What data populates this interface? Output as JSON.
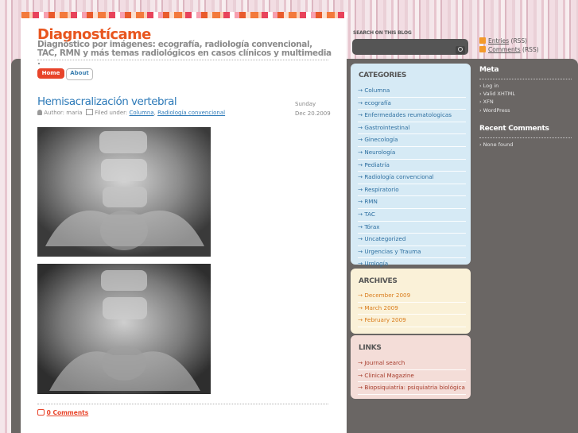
{
  "blog": {
    "title": "Diagnostícame",
    "tagline": "Diagnóstico por imágenes: ecografía, radiología convencional, TAC, RMN y más temas radiológicos en casos clínicos y multimedia ."
  },
  "nav": {
    "home": "Home",
    "about": "About"
  },
  "post": {
    "title": "Hemisacralización vertebral",
    "day": "Sunday",
    "date": "Dec 20.2009",
    "author_label": "Author: maria",
    "filed_label": "Filed under:",
    "categories": [
      "Columna",
      "Radiología convencional"
    ],
    "comments": "0 Comments"
  },
  "search": {
    "label": "SEARCH ON THIS BLOG",
    "placeholder": ""
  },
  "feeds": {
    "entries_link": "Entries",
    "entries_suffix": "(RSS)",
    "comments_link": "Comments",
    "comments_suffix": "(RSS)"
  },
  "categories": {
    "heading": "CATEGORIES",
    "items": [
      "Columna",
      "ecografía",
      "Enfermedades reumatologicas",
      "Gastrointestinal",
      "Ginecología",
      "Neurología",
      "Pediatría",
      "Radiología convencional",
      "Respiratorio",
      "RMN",
      "TAC",
      "Tórax",
      "Uncategorized",
      "Urgencias y Trauma",
      "Urología"
    ]
  },
  "archives": {
    "heading": "ARCHIVES",
    "items": [
      "December 2009",
      "March 2009",
      "February 2009"
    ]
  },
  "links": {
    "heading": "LINKS",
    "items": [
      "Journal search",
      "Clinical Magazine",
      "Biopsiquiatría: psiquiatria biológica"
    ]
  },
  "meta": {
    "heading": "Meta",
    "items": [
      "Log in",
      "Valid XHTML",
      "XFN",
      "WordPress"
    ]
  },
  "recent_comments": {
    "heading": "Recent Comments",
    "empty": "None found"
  },
  "colors": {
    "accent": "#e8561f",
    "link": "#2d7ab8",
    "sidebar_dark": "#6a6664"
  }
}
